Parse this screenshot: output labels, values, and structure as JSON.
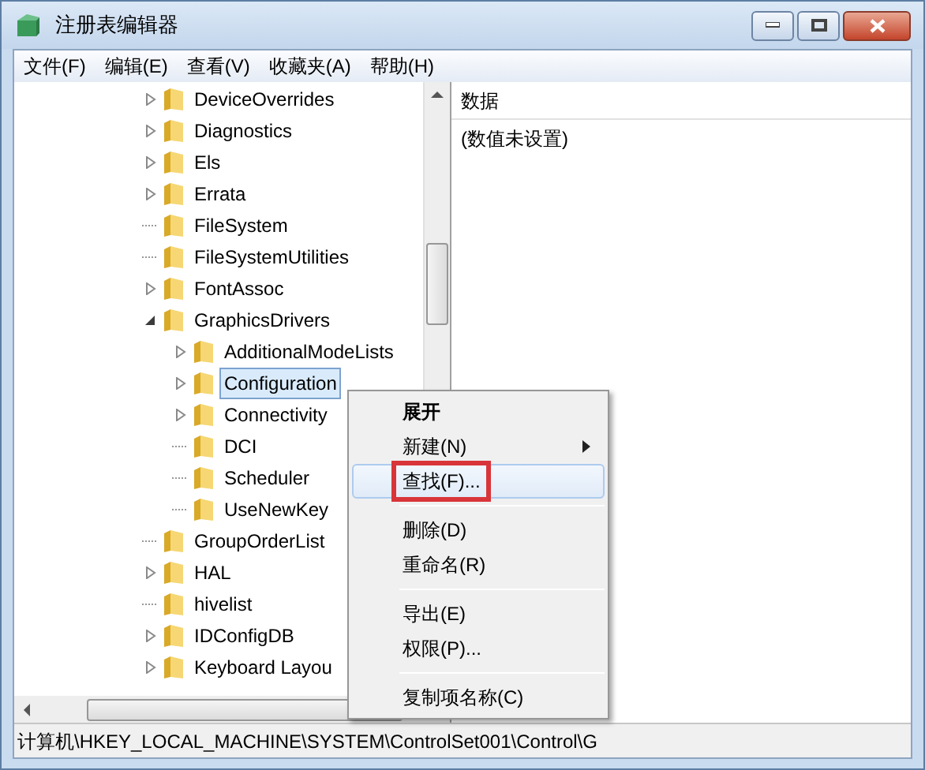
{
  "window": {
    "title": "注册表编辑器"
  },
  "menu_bar": [
    "文件(F)",
    "编辑(E)",
    "查看(V)",
    "收藏夹(A)",
    "帮助(H)"
  ],
  "tree": [
    {
      "label": "DeviceOverrides",
      "expandable": true,
      "expanded": false,
      "selected": false
    },
    {
      "label": "Diagnostics",
      "expandable": true,
      "expanded": false,
      "selected": false
    },
    {
      "label": "Els",
      "expandable": true,
      "expanded": false,
      "selected": false
    },
    {
      "label": "Errata",
      "expandable": true,
      "expanded": false,
      "selected": false
    },
    {
      "label": "FileSystem",
      "expandable": false,
      "selected": false
    },
    {
      "label": "FileSystemUtilities",
      "expandable": false,
      "selected": false
    },
    {
      "label": "FontAssoc",
      "expandable": true,
      "expanded": false,
      "selected": false
    },
    {
      "label": "GraphicsDrivers",
      "expandable": true,
      "expanded": true,
      "selected": false,
      "children": [
        {
          "label": "AdditionalModeLists",
          "expandable": true,
          "expanded": false,
          "selected": false
        },
        {
          "label": "Configuration",
          "expandable": true,
          "expanded": false,
          "selected": true
        },
        {
          "label": "Connectivity",
          "expandable": true,
          "expanded": false,
          "selected": false
        },
        {
          "label": "DCI",
          "expandable": false,
          "selected": false
        },
        {
          "label": "Scheduler",
          "expandable": false,
          "selected": false
        },
        {
          "label": "UseNewKey",
          "expandable": false,
          "selected": false
        }
      ]
    },
    {
      "label": "GroupOrderList",
      "expandable": false,
      "selected": false
    },
    {
      "label": "HAL",
      "expandable": true,
      "expanded": false,
      "selected": false
    },
    {
      "label": "hivelist",
      "expandable": false,
      "selected": false
    },
    {
      "label": "IDConfigDB",
      "expandable": true,
      "expanded": false,
      "selected": false
    },
    {
      "label": "Keyboard Layou",
      "expandable": true,
      "expanded": false,
      "selected": false
    }
  ],
  "data_pane": {
    "header": "数据",
    "value": "(数值未设置)"
  },
  "context_menu": [
    {
      "kind": "item",
      "label": "展开",
      "bold": true,
      "submenu": false,
      "selected": false,
      "annotated": false
    },
    {
      "kind": "item",
      "label": "新建(N)",
      "bold": false,
      "submenu": true,
      "selected": false,
      "annotated": false
    },
    {
      "kind": "item",
      "label": "查找(F)...",
      "bold": false,
      "submenu": false,
      "selected": true,
      "annotated": true
    },
    {
      "kind": "separator"
    },
    {
      "kind": "item",
      "label": "删除(D)",
      "bold": false,
      "submenu": false,
      "selected": false,
      "annotated": false
    },
    {
      "kind": "item",
      "label": "重命名(R)",
      "bold": false,
      "submenu": false,
      "selected": false,
      "annotated": false
    },
    {
      "kind": "separator"
    },
    {
      "kind": "item",
      "label": "导出(E)",
      "bold": false,
      "submenu": false,
      "selected": false,
      "annotated": false
    },
    {
      "kind": "item",
      "label": "权限(P)...",
      "bold": false,
      "submenu": false,
      "selected": false,
      "annotated": false
    },
    {
      "kind": "separator"
    },
    {
      "kind": "item",
      "label": "复制项名称(C)",
      "bold": false,
      "submenu": false,
      "selected": false,
      "annotated": false
    }
  ],
  "status_bar": "计算机\\HKEY_LOCAL_MACHINE\\SYSTEM\\ControlSet001\\Control\\G"
}
